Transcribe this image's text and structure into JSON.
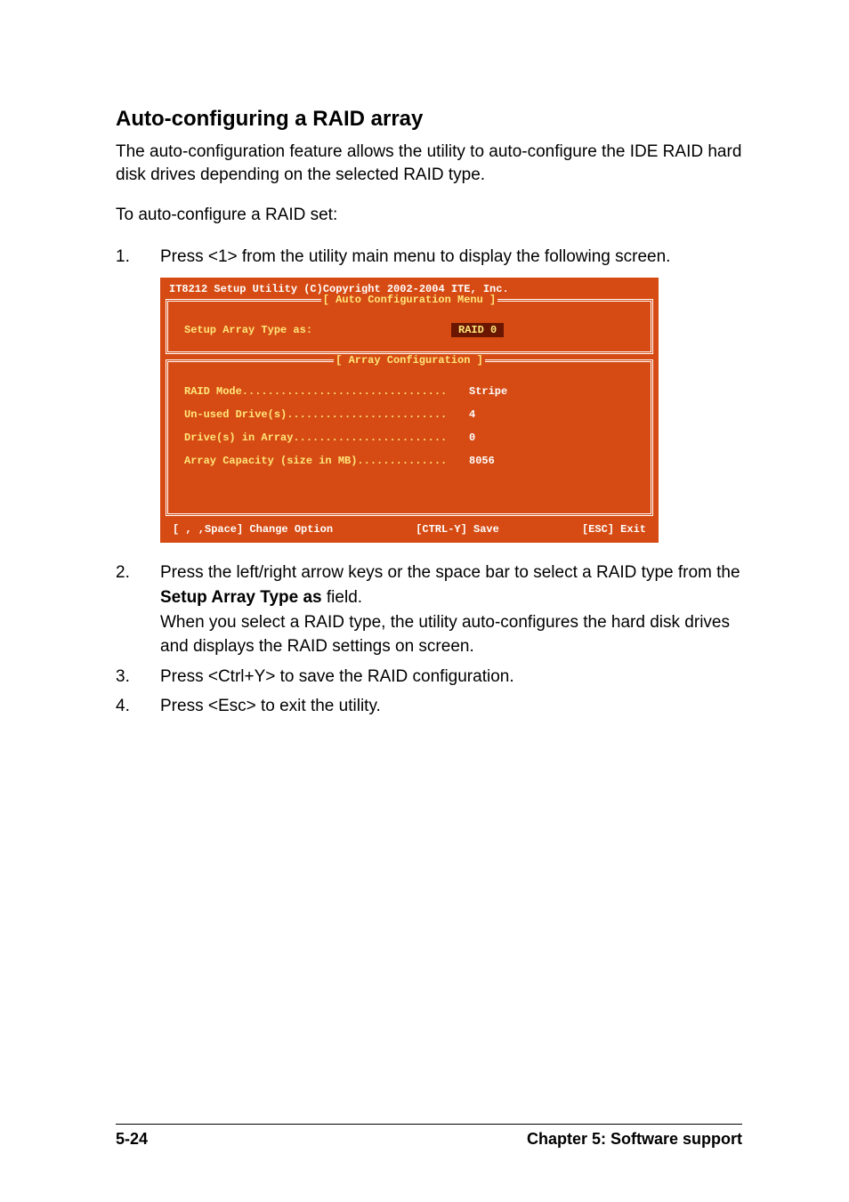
{
  "heading": "Auto-configuring a RAID array",
  "intro": "The auto-configuration feature allows the utility to auto-configure the IDE RAID hard disk drives depending on the selected RAID type.",
  "lead": "To auto-configure a RAID set:",
  "steps": {
    "s1": {
      "num": "1.",
      "text": "Press <1> from the utility main menu to display the following screen."
    },
    "s2": {
      "num": "2.",
      "pre": "Press the left/right arrow keys or the space bar to select a RAID type from the ",
      "bold": "Setup Array Type as",
      "post": " field.",
      "line2": "When you select a RAID type, the utility auto-configures the hard disk drives and displays the RAID settings on screen."
    },
    "s3": {
      "num": "3.",
      "text": "Press <Ctrl+Y> to save the RAID configuration."
    },
    "s4": {
      "num": "4.",
      "text": "Press <Esc> to exit the utility."
    }
  },
  "bios": {
    "title": "IT8212 Setup Utility (C)Copyright 2002-2004 ITE, Inc.",
    "panel1_label": "[ Auto Configuration Menu ]",
    "panel2_label": "[ Array Configuration ]",
    "setup_label": "Setup Array Type as:",
    "setup_value": "RAID 0",
    "rows": {
      "r1": {
        "label": "RAID Mode................................",
        "value": "Stripe"
      },
      "r2": {
        "label": "Un-used Drive(s).........................",
        "value": "4"
      },
      "r3": {
        "label": "Drive(s) in Array........................",
        "value": "0"
      },
      "r4": {
        "label": "Array Capacity (size in MB)..............",
        "value": "8056"
      }
    },
    "footer": {
      "f1": "[ , ,Space] Change Option",
      "f2": "[CTRL-Y] Save",
      "f3": "[ESC] Exit"
    }
  },
  "footer": {
    "left": "5-24",
    "right": "Chapter 5: Software support"
  }
}
